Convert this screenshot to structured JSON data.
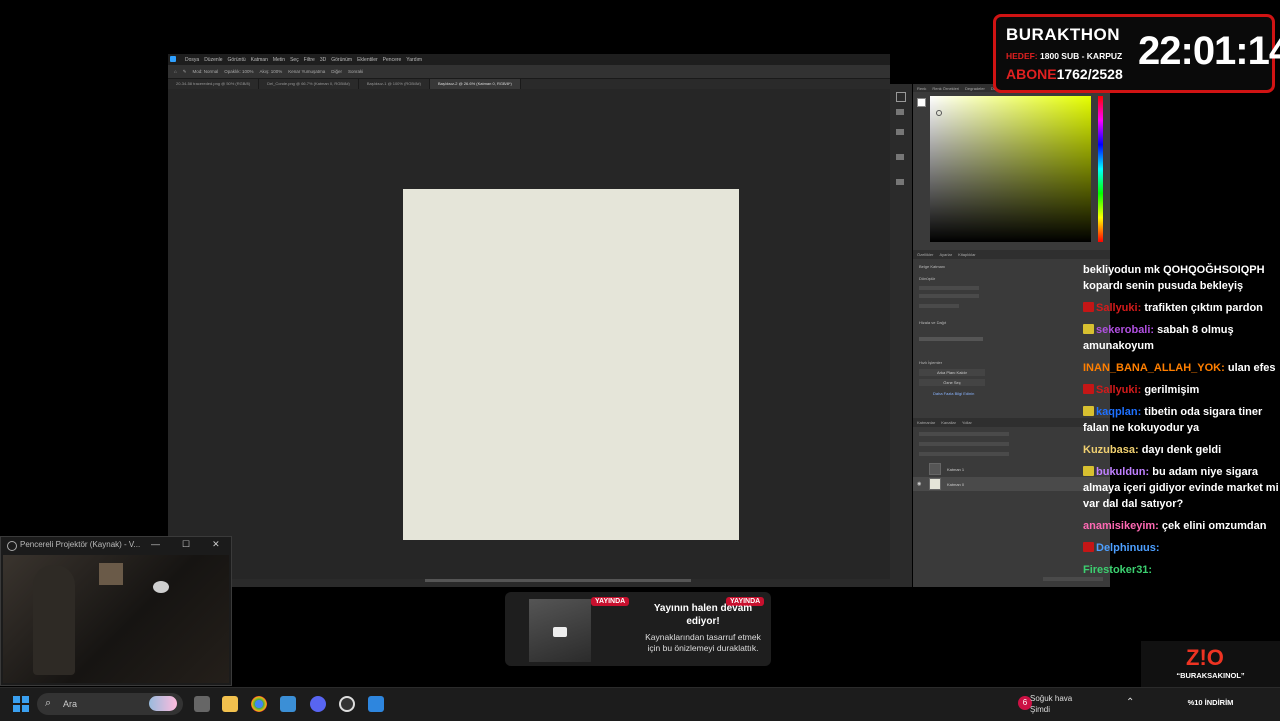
{
  "ps": {
    "menu": [
      "Dosya",
      "Düzenle",
      "Görüntü",
      "Katman",
      "Metin",
      "Seç",
      "Filtre",
      "3D",
      "Görünüm",
      "Eklentiler",
      "Pencere",
      "Yardım"
    ],
    "options": [
      "Mod: Normal",
      "Opaklık: 100%",
      "Akış: 100%",
      "Kenar Yumuşatma",
      "Diğer",
      "Sonraki"
    ],
    "tabs": [
      {
        "label": "20-34-58 tracereded.png @ 50% (RGB/8)",
        "active": false
      },
      {
        "label": "Del_Conde.png @ 66.7% (Katman 0, RGB/8#)",
        "active": false
      },
      {
        "label": "Başlıksız-1 @ 100% (RGB/8#)",
        "active": false
      },
      {
        "label": "Başlıksız-2 @ 26.6% (Katman 0, RGB/8*)",
        "active": true
      }
    ],
    "doc_color": "#e5e5d9",
    "color_tabs": [
      "Renk",
      "Renk Örnekleri",
      "Degradeler",
      "Desenler"
    ],
    "props_tabs": [
      "Özellikler",
      "Ayarlar",
      "Kitaplıklar"
    ],
    "props_labels": [
      "Belge Katmanı",
      "Dönüştür",
      "Hizala ve Dağıt",
      "Hızlı İşlemler",
      "Arka Planı Kaldır",
      "Özne Seç",
      "Daha Fazla Bilgi Edinin"
    ],
    "layers_tabs": [
      "Katmanlar",
      "Kanallar",
      "Yollar"
    ],
    "layers": [
      {
        "name": "Katman 1",
        "visible": false
      },
      {
        "name": "Katman 0",
        "visible": true
      }
    ]
  },
  "overlay": {
    "title": "BURAKTHON",
    "hedef_label": "HEDEF:",
    "hedef_value": "1800 SUB - KARPUZ",
    "abone_label": "ABONE",
    "abone_value": "1762/2528",
    "clock": "22:01:14"
  },
  "chat": [
    {
      "user": "",
      "color": "#ffffff",
      "badge": "",
      "text": "bekliyodun mk QOHQOĞHSOIQPH kopardı senin pusuda bekleyiş"
    },
    {
      "user": "Sallyuki:",
      "color": "#d41b1b",
      "badge": "#c41616",
      "text": "trafikten çıktım pardon"
    },
    {
      "user": "sekerobali:",
      "color": "#b050e0",
      "badge": "#d8c030",
      "text": "sabah 8 olmuş amunakoyum"
    },
    {
      "user": "INAN_BANA_ALLAH_YOK:",
      "color": "#ff7f00",
      "badge": "",
      "text": "ulan efes"
    },
    {
      "user": "Sallyuki:",
      "color": "#d41b1b",
      "badge": "#c41616",
      "text": "gerilmişim"
    },
    {
      "user": "kaqplan:",
      "color": "#1e70ff",
      "badge": "#d8c030",
      "text": "tibetin oda sigara tiner falan ne kokuyodur ya"
    },
    {
      "user": "Kuzubasa:",
      "color": "#f0d070",
      "badge": "",
      "text": "dayı denk geldi"
    },
    {
      "user": "bukuldun:",
      "color": "#c080ff",
      "badge": "#d8c030",
      "text": "bu adam niye sigara almaya içeri gidiyor evinde market mi var dal dal satıyor?"
    },
    {
      "user": "anamisikeyim:",
      "color": "#ff69b4",
      "badge": "",
      "text": "çek elini omzumdan"
    },
    {
      "user": "Delphinuus:",
      "color": "#4d9fff",
      "badge": "#c41616",
      "text": ""
    },
    {
      "user": "Firestoker31:",
      "color": "#3cd070",
      "badge": "",
      "text": ""
    }
  ],
  "projector": {
    "title": "Pencereli Projektör (Kaynak) - V...",
    "minimize": "—",
    "maximize": "☐",
    "close": "✕"
  },
  "notification": {
    "badge": "YAYINDA",
    "title": "Yayının halen devam ediyor!",
    "subtitle": "Kaynaklarından tasarruf etmek için bu önizlemeyi duraklattık."
  },
  "ad": {
    "logo": "Z!O",
    "line1": "“BURAKSAKINOL”",
    "line2": "%10 İNDİRİM"
  },
  "taskbar": {
    "search_placeholder": "Ara",
    "weather_title": "Soğuk hava",
    "weather_sub": "Şimdi",
    "weather_badge": "6"
  }
}
